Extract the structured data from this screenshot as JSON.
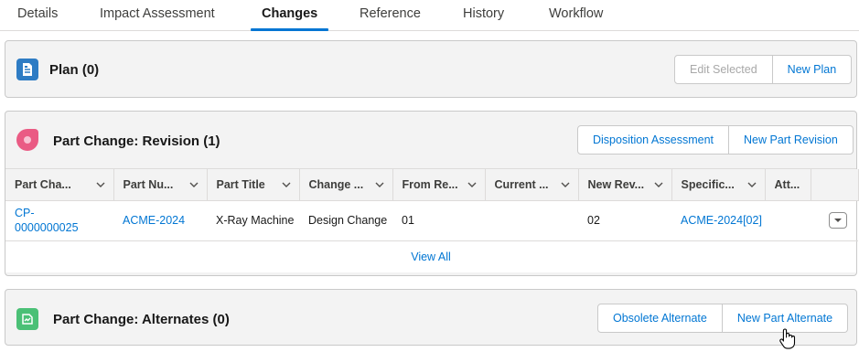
{
  "tabs": [
    "Details",
    "Impact Assessment",
    "Changes",
    "Reference",
    "History",
    "Workflow"
  ],
  "active_tab": "Changes",
  "plan": {
    "title": "Plan (0)",
    "edit_selected_label": "Edit Selected",
    "new_plan_label": "New Plan"
  },
  "revision": {
    "title": "Part Change: Revision (1)",
    "disposition_label": "Disposition Assessment",
    "new_revision_label": "New Part Revision",
    "columns": [
      "Part Cha...",
      "Part Nu...",
      "Part Title",
      "Change ...",
      "From Re...",
      "Current ...",
      "New Rev...",
      "Specific...",
      "Att..."
    ],
    "row": {
      "part_change": "CP-0000000025",
      "part_number": "ACME-2024",
      "part_title": "X-Ray Machine",
      "change_type": "Design Change",
      "from_revision": "01",
      "current": "",
      "new_revision": "02",
      "specification": "ACME-2024[02]",
      "attachments": ""
    },
    "view_all_label": "View All"
  },
  "alternates": {
    "title": "Part Change: Alternates (0)",
    "obsolete_label": "Obsolete Alternate",
    "new_alternate_label": "New Part Alternate"
  },
  "colors": {
    "accent": "#0176d3",
    "plan_icon": "#2e7cc4",
    "revision_icon": "#ea5b84",
    "alternates_icon": "#4bc076"
  },
  "icons": [
    "document-icon",
    "revision-icon",
    "alternate-icon",
    "chevron-down-icon",
    "hand-cursor-icon"
  ]
}
